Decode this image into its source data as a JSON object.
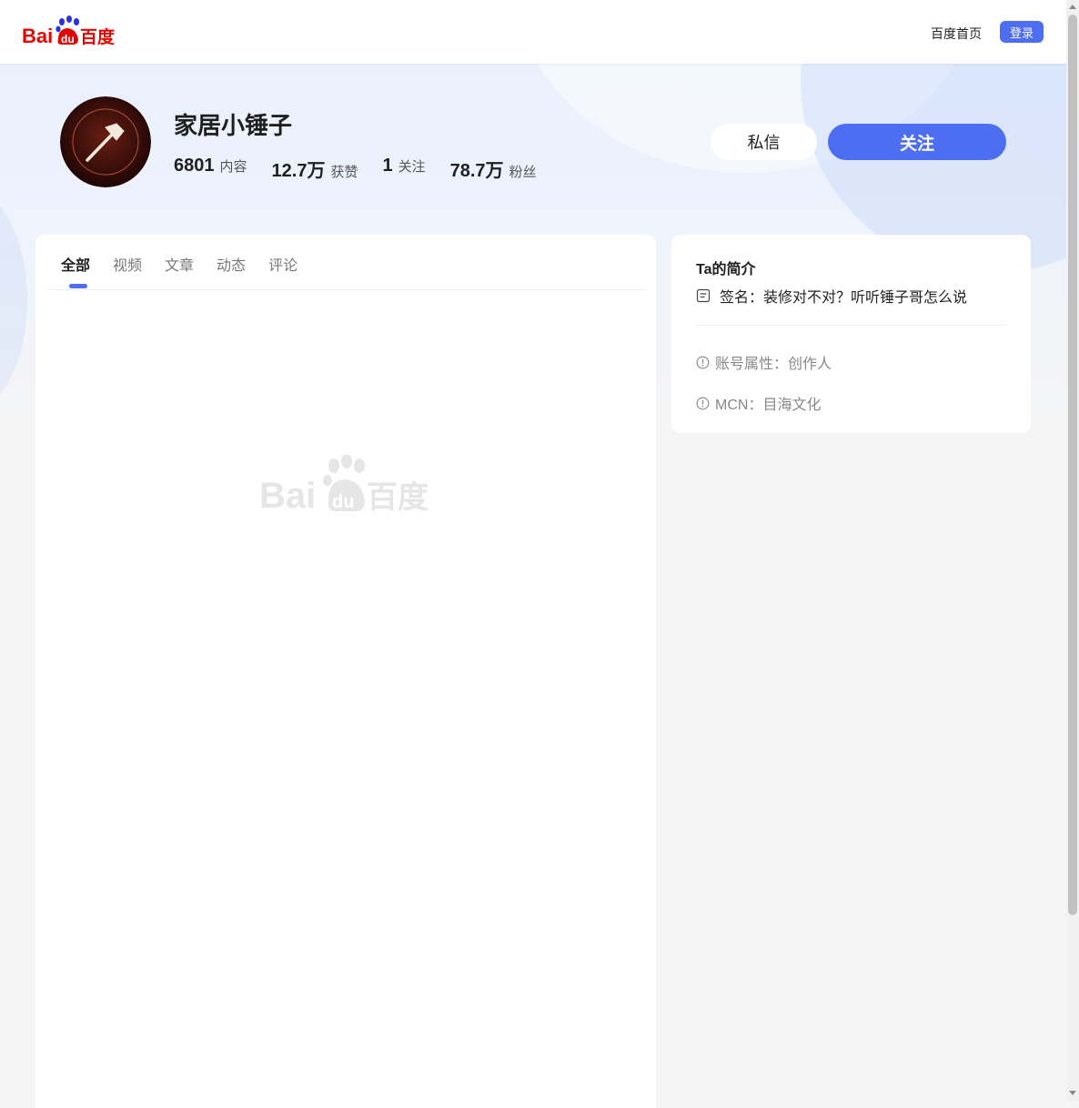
{
  "header": {
    "logo_text": "Bai百度",
    "home_label": "百度首页",
    "login_label": "登录"
  },
  "profile": {
    "name": "家居小锤子",
    "stats": [
      {
        "value": "6801",
        "label": "内容"
      },
      {
        "value": "12.7万",
        "label": "获赞"
      },
      {
        "value": "1",
        "label": "关注"
      },
      {
        "value": "78.7万",
        "label": "粉丝"
      }
    ],
    "message_label": "私信",
    "follow_label": "关注"
  },
  "tabs": [
    "全部",
    "视频",
    "文章",
    "动态",
    "评论"
  ],
  "active_tab": "全部",
  "intro": {
    "title": "Ta的简介",
    "signature": "签名：装修对不对？听听锤子哥怎么说",
    "account_type": "账号属性：创作人",
    "mcn": "MCN：目海文化"
  },
  "colors": {
    "accent": "#4e6ef2",
    "baidu_red": "#e10602",
    "baidu_blue": "#2932e1"
  }
}
